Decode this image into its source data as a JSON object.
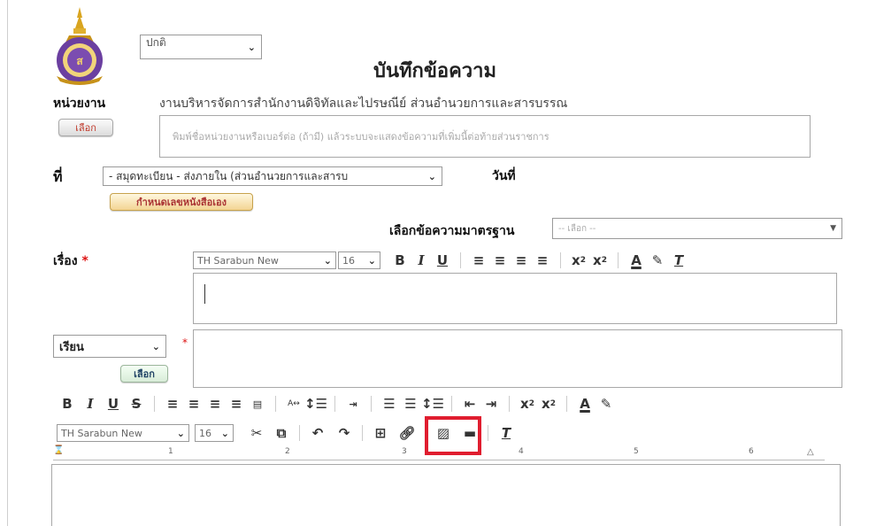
{
  "header": {
    "style_select_value": "ปกติ",
    "title": "บันทึกข้อความ"
  },
  "unit": {
    "label": "หน่วยงาน",
    "value": "งานบริหารจัดการสำนักงานดิจิทัลและไปรษณีย์ ส่วนอำนวยการและสารบรรณ",
    "select_button": "เลือก",
    "placeholder": "พิมพ์ชื่อหน่วยงานหรือเบอร์ต่อ (ถ้ามี) แล้วระบบจะแสดงข้อความที่เพิ่มนี้ต่อท้ายส่วนราชการ"
  },
  "ref": {
    "label": "ที่",
    "select_value": "- สมุดทะเบียน - ส่งภายใน (ส่วนอำนวยการและสารบ",
    "custom_number_button": "กำหนดเลขหนังสือเอง",
    "date_label": "วันที่"
  },
  "standard": {
    "label": "เลือกข้อความมาตรฐาน",
    "select_value": "-- เลือก --"
  },
  "subject": {
    "label": "เรื่อง",
    "required_mark": "*",
    "font_select": "TH Sarabun New",
    "size_select": "16"
  },
  "salutation": {
    "select_value": "เรียน",
    "required_mark": "*",
    "select_button": "เลือก"
  },
  "body_editor": {
    "font_select": "TH Sarabun New",
    "size_select": "16",
    "ruler_numbers": [
      "1",
      "2",
      "3",
      "4",
      "5",
      "6"
    ]
  },
  "colors": {
    "highlight": "#e01d2f",
    "required": "#dd1111",
    "button_text": "#c0392b"
  }
}
